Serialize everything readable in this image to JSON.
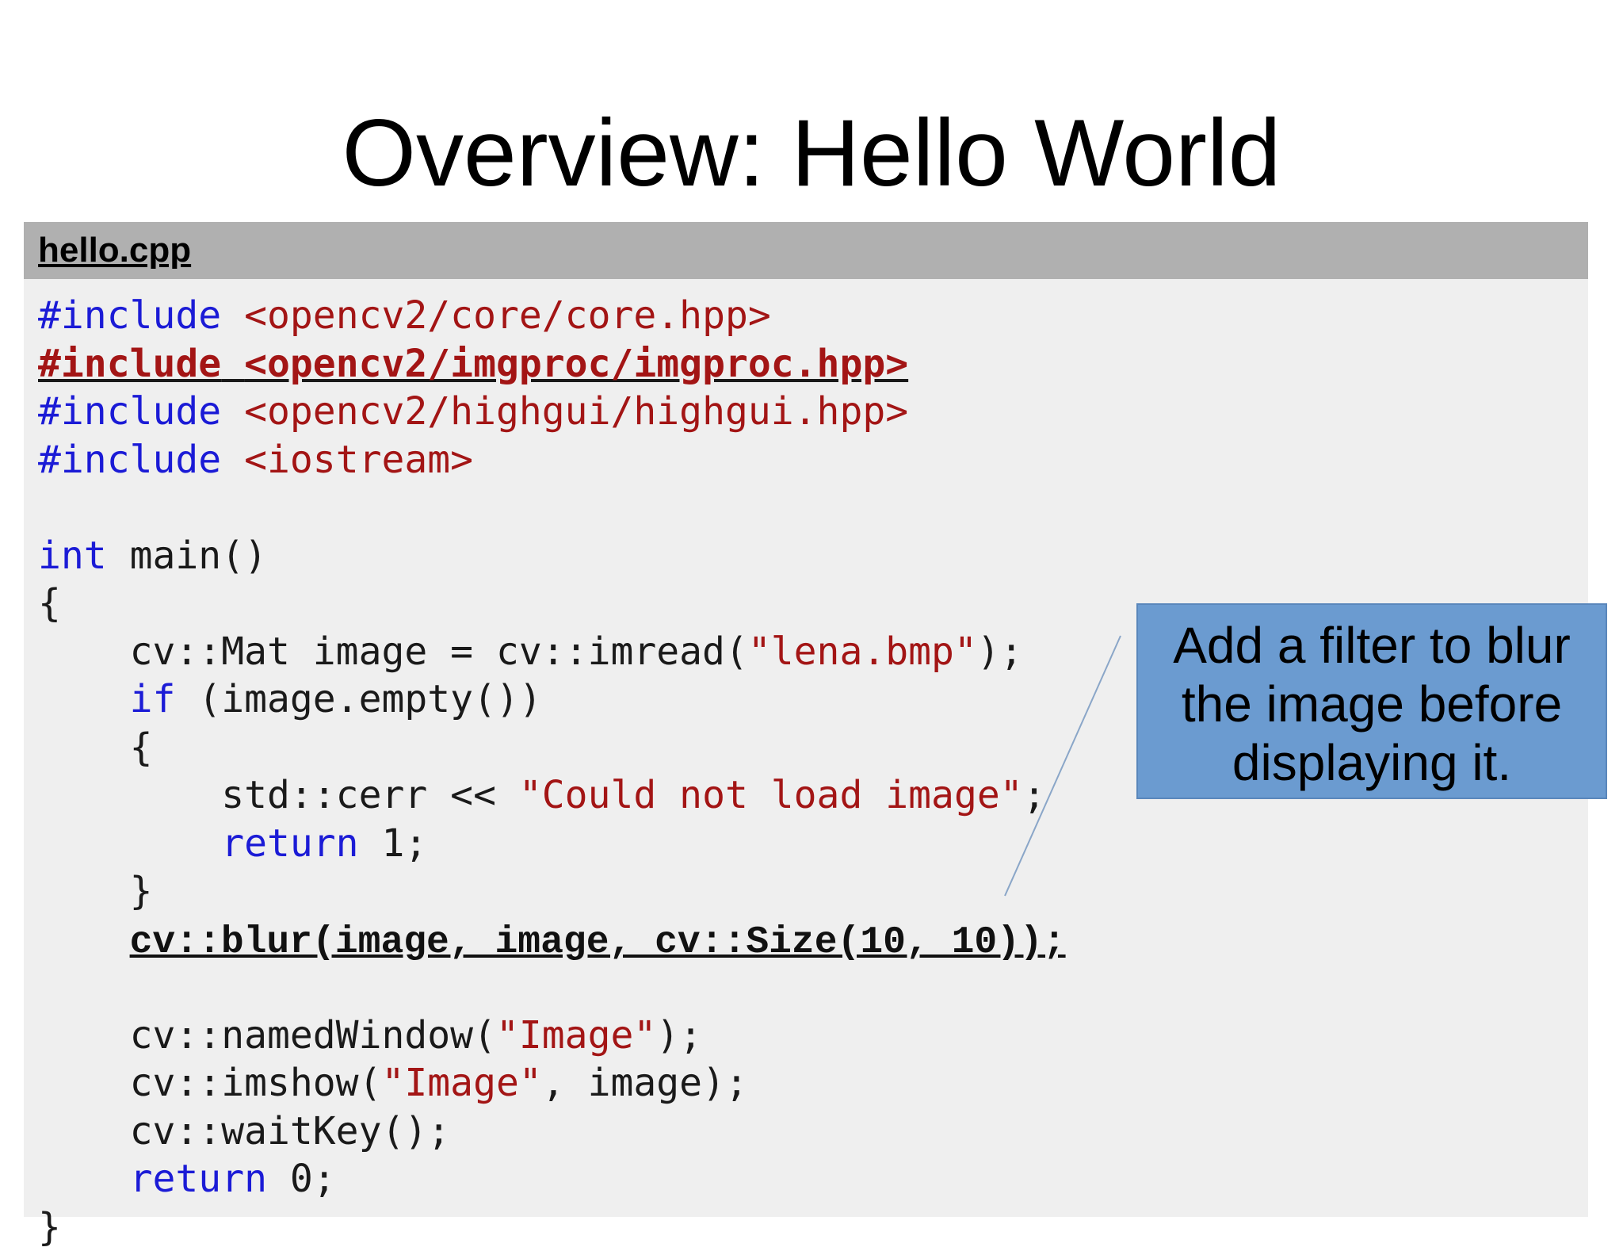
{
  "slide": {
    "title": "Overview: Hello World"
  },
  "code_panel": {
    "file_name": "hello.cpp",
    "lines": [
      [
        {
          "t": "#include",
          "c": "kw"
        },
        {
          "t": " ",
          "c": ""
        },
        {
          "t": "<opencv2/core/core.hpp>",
          "c": "str"
        }
      ],
      [
        {
          "t": "#include",
          "c": "kw"
        },
        {
          "t": " ",
          "c": ""
        },
        {
          "t": "<opencv2/imgproc/imgproc.hpp>",
          "c": "str"
        }
      ],
      [
        {
          "t": "#include",
          "c": "kw"
        },
        {
          "t": " ",
          "c": ""
        },
        {
          "t": "<opencv2/highgui/highgui.hpp>",
          "c": "str"
        }
      ],
      [
        {
          "t": "#include",
          "c": "kw"
        },
        {
          "t": " ",
          "c": ""
        },
        {
          "t": "<iostream>",
          "c": "str"
        }
      ],
      [
        {
          "t": "",
          "c": ""
        }
      ],
      [
        {
          "t": "int",
          "c": "kw"
        },
        {
          "t": " main()",
          "c": ""
        }
      ],
      [
        {
          "t": "{",
          "c": ""
        }
      ],
      [
        {
          "t": "    cv::Mat image = cv::imread(",
          "c": ""
        },
        {
          "t": "\"lena.bmp\"",
          "c": "str"
        },
        {
          "t": ");",
          "c": ""
        }
      ],
      [
        {
          "t": "    ",
          "c": ""
        },
        {
          "t": "if",
          "c": "kw"
        },
        {
          "t": " (image.empty())",
          "c": ""
        }
      ],
      [
        {
          "t": "    {",
          "c": ""
        }
      ],
      [
        {
          "t": "        std::cerr << ",
          "c": ""
        },
        {
          "t": "\"Could not load image\"",
          "c": "str"
        },
        {
          "t": ";",
          "c": ""
        }
      ],
      [
        {
          "t": "        ",
          "c": ""
        },
        {
          "t": "return",
          "c": "kw"
        },
        {
          "t": " 1;",
          "c": ""
        }
      ],
      [
        {
          "t": "    }",
          "c": ""
        }
      ],
      [
        {
          "t": "    ",
          "c": ""
        },
        {
          "t": "cv::blur(image, image, cv::Size(10, 10));",
          "c": "blur"
        }
      ],
      [
        {
          "t": "",
          "c": ""
        }
      ],
      [
        {
          "t": "    cv::namedWindow(",
          "c": ""
        },
        {
          "t": "\"Image\"",
          "c": "str"
        },
        {
          "t": ");",
          "c": ""
        }
      ],
      [
        {
          "t": "    cv::imshow(",
          "c": ""
        },
        {
          "t": "\"Image\"",
          "c": "str"
        },
        {
          "t": ", image);",
          "c": ""
        }
      ],
      [
        {
          "t": "    cv::waitKey();",
          "c": ""
        }
      ],
      [
        {
          "t": "    ",
          "c": ""
        },
        {
          "t": "return",
          "c": "kw"
        },
        {
          "t": " 0;",
          "c": ""
        }
      ],
      [
        {
          "t": "}",
          "c": ""
        }
      ]
    ],
    "highlighted_line_index": 1
  },
  "callout": {
    "lines": [
      "Add a filter to blur",
      "the image before",
      "displaying it."
    ],
    "background": "#6b9bd0"
  },
  "colors": {
    "keyword": "#1b1bd6",
    "string": "#a31515",
    "header_bar": "#b0b0b0",
    "panel": "#efefef"
  }
}
